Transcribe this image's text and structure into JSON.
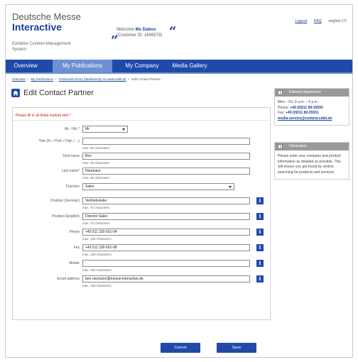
{
  "header": {
    "logo_line1": "Deutsche Messe",
    "logo_line2": "Interactive",
    "subtitle": "Exhibitor Content Management System",
    "welcome_prefix": "Welcome",
    "welcome_name": "Ms Dabou",
    "customer_id": "(Customer ID: 1606573)",
    "quote_open": "”",
    "quote_close": "“",
    "links": {
      "logout": "Logout",
      "faq": "FAQ",
      "language": "english (?)"
    }
  },
  "nav": {
    "tabs": [
      {
        "label": "Overview",
        "active": false
      },
      {
        "label": "My Publications",
        "active": true
      },
      {
        "label": "My Company",
        "active": false
      },
      {
        "label": "Media Gallery",
        "active": false
      }
    ]
  },
  "breadcrumb": [
    "Overview",
    "My Publications",
    "Publication Entry (details/entry on www.cebit.de",
    "Edit Contact Partner"
  ],
  "page_title": "Edit Contact Partner",
  "form": {
    "required_note": "Please fill in all fields marked with *",
    "fields": {
      "salutation": {
        "label": "Mr. / Ms.*",
        "value": "Mr."
      },
      "title": {
        "label": "Title (Dr. / Prof. / Dipl. / ...)",
        "value": "",
        "hint": "max. 60 characters"
      },
      "first_name": {
        "label": "First name",
        "value": "Ben",
        "hint": "max. 35 characters"
      },
      "last_name": {
        "label": "Last name*",
        "value": "Neumann",
        "hint": "max. 35 characters"
      },
      "function": {
        "label": "Function",
        "value": "Sales"
      },
      "position_de": {
        "label": "Position (German)",
        "value": "Vertriebsleiter",
        "hint": "max. 70 characters"
      },
      "position_en": {
        "label": "Position (English)",
        "value": "Director Sales",
        "hint": "max. 70 characters"
      },
      "phone": {
        "label": "Phone",
        "value": "+49 511 330 601-04",
        "hint": "max. 150 characters"
      },
      "fax": {
        "label": "Fax",
        "value": "+49 511 330 601-08",
        "hint": "max. 150 characters"
      },
      "mobile": {
        "label": "Mobile",
        "value": "",
        "hint": "max. 150 characters"
      },
      "email": {
        "label": "Email address",
        "value": "ben.neumann@messe-interactive.de",
        "hint": "max. 150 characters"
      }
    },
    "info_glyph": "i",
    "buttons": {
      "cancel": "Cancel",
      "save": "Save"
    }
  },
  "sidebar": {
    "editorial": {
      "title": "Editorial department",
      "hours": "Mon – Fri, 9 a.m. – 6 p.m.",
      "phone_label": "Phone:",
      "phone": "+49 (0)511 89-35550",
      "fax_label": "Fax:",
      "fax": "+49 (0)511 89-35551",
      "email": "media-service@content.cebit.de"
    },
    "information": {
      "title": "Information",
      "text": "Please enter your company and product information as detailed as possible. This will ensure you get found by visitors searching for products and services."
    }
  },
  "colors": {
    "brand": "#1f4aa8",
    "active_tab": "#6f8fd3",
    "required": "#dd1111",
    "side_header": "#9a9a9a"
  }
}
